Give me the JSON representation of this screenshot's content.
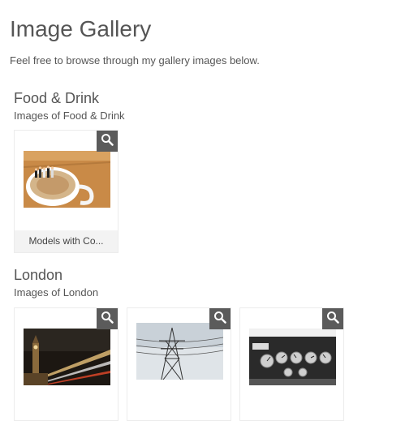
{
  "page": {
    "title": "Image Gallery",
    "intro": "Feel free to browse through my gallery images below."
  },
  "categories": [
    {
      "title": "Food & Drink",
      "subtitle": "Images of Food & Drink",
      "items": [
        {
          "caption": "Models with Co...",
          "image": "coffee-cup-with-figurines-photo"
        }
      ]
    },
    {
      "title": "London",
      "subtitle": "Images of London",
      "items": [
        {
          "image": "big-ben-night-traffic-photo"
        },
        {
          "image": "electricity-pylon-photo"
        },
        {
          "image": "car-dashboard-dials-photo"
        }
      ]
    }
  ],
  "icons": {
    "zoom": "magnifier-icon"
  },
  "colors": {
    "zoom_bg": "#5b5b5b",
    "caption_bg": "#f3f3f3",
    "text": "#555555"
  }
}
